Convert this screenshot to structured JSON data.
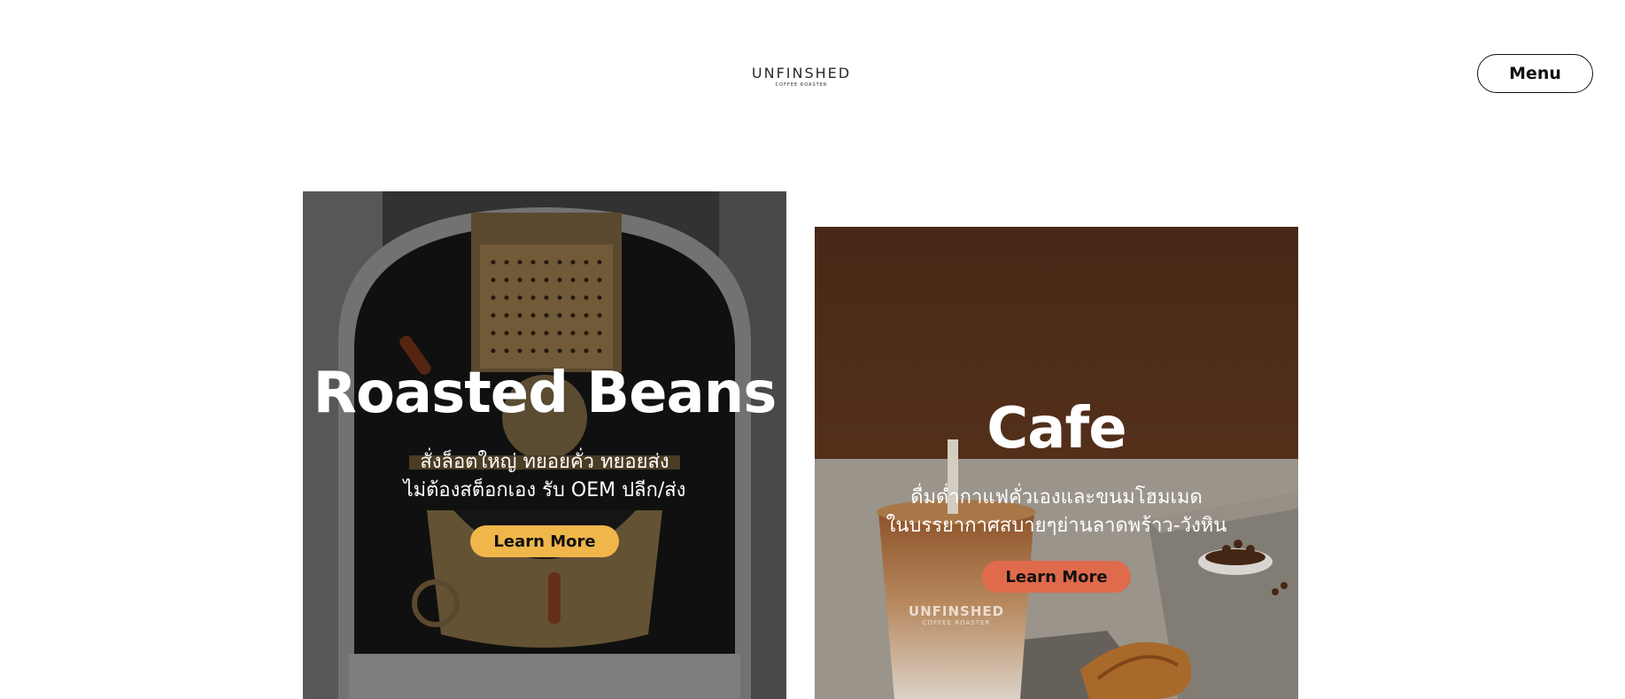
{
  "header": {
    "logo_text": "UNFINSHED",
    "logo_subtext": "COFFEE ROASTER",
    "menu_label": "Menu"
  },
  "cards": [
    {
      "title": "Roasted Beans",
      "description_lines": [
        "สั่งล็อตใหญ่ ทยอยคั่ว ทยอยส่ง",
        "ไม่ต้องสต็อกเอง รับ OEM ปลีก/ส่ง"
      ],
      "button_label": "Learn More",
      "button_color": "#f0b64a"
    },
    {
      "title": "Cafe",
      "description_lines": [
        "ดื่มด่ำกาแฟคั่วเองและขนมโฮมเมด",
        "ในบรรยากาศสบายๆย่านลาดพร้าว-วังหิน"
      ],
      "button_label": "Learn More",
      "button_color": "#e06a4c",
      "cup_logo_text": "UNFINSHED",
      "cup_logo_subtext": "COFFEE ROASTER"
    }
  ]
}
